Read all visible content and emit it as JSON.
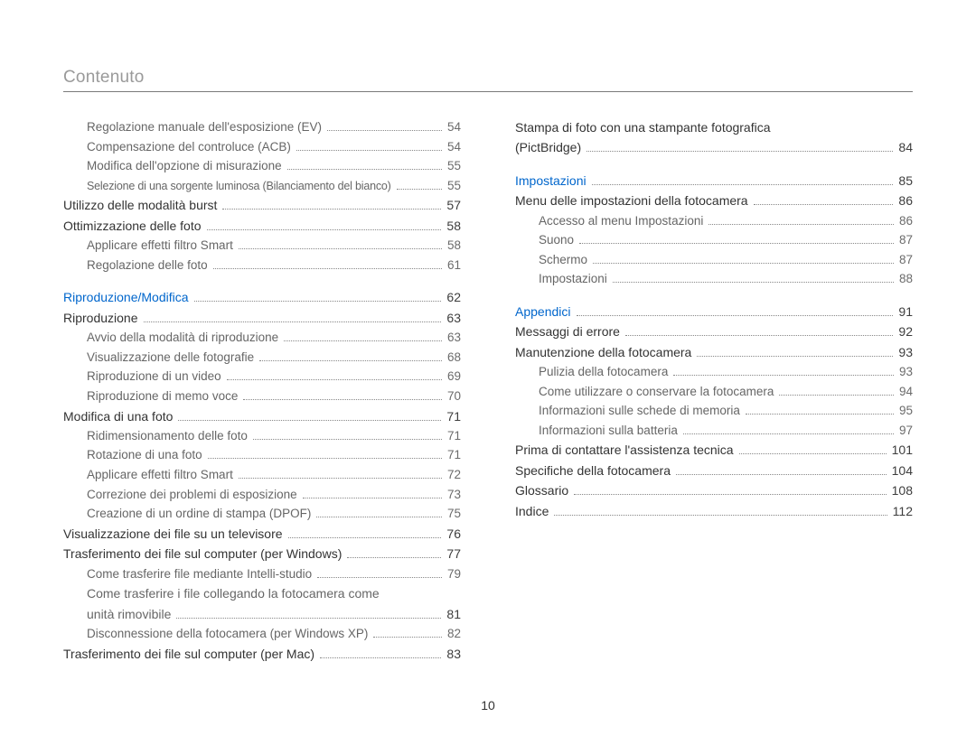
{
  "header": {
    "title": "Contenuto"
  },
  "page_number": "10",
  "left_col": [
    {
      "cls": "level-2",
      "label": "Regolazione manuale dell'esposizione (EV)",
      "page": "54"
    },
    {
      "cls": "level-2",
      "label": "Compensazione del controluce (ACB)",
      "page": "54"
    },
    {
      "cls": "level-2",
      "label": "Modifica dell'opzione di misurazione",
      "page": "55"
    },
    {
      "cls": "level-2 tight",
      "label": "Selezione di una sorgente luminosa (Bilanciamento del bianco)",
      "page": "55"
    },
    {
      "cls": "level-1",
      "label": "Utilizzo delle modalità burst",
      "page": "57"
    },
    {
      "cls": "level-1",
      "label": "Ottimizzazione delle foto",
      "page": "58"
    },
    {
      "cls": "level-2",
      "label": "Applicare effetti filtro Smart",
      "page": "58"
    },
    {
      "cls": "level-2",
      "label": "Regolazione delle foto",
      "page": "61"
    },
    {
      "spacer": true
    },
    {
      "cls": "level-1 section-head",
      "label": "Riproduzione/Modifica",
      "page": "62"
    },
    {
      "cls": "level-1",
      "label": "Riproduzione",
      "page": "63"
    },
    {
      "cls": "level-2",
      "label": "Avvio della modalità di riproduzione",
      "page": "63"
    },
    {
      "cls": "level-2",
      "label": "Visualizzazione delle fotografie",
      "page": "68"
    },
    {
      "cls": "level-2",
      "label": "Riproduzione di un video",
      "page": "69"
    },
    {
      "cls": "level-2",
      "label": "Riproduzione di memo voce",
      "page": "70"
    },
    {
      "cls": "level-1",
      "label": "Modifica di una foto",
      "page": "71"
    },
    {
      "cls": "level-2",
      "label": "Ridimensionamento delle foto",
      "page": "71"
    },
    {
      "cls": "level-2",
      "label": "Rotazione di una foto",
      "page": "71"
    },
    {
      "cls": "level-2",
      "label": "Applicare effetti filtro Smart",
      "page": "72"
    },
    {
      "cls": "level-2",
      "label": "Correzione dei problemi di esposizione",
      "page": "73"
    },
    {
      "cls": "level-2",
      "label": "Creazione di un ordine di stampa (DPOF)",
      "page": "75"
    },
    {
      "cls": "level-1",
      "label": "Visualizzazione dei file su un televisore",
      "page": "76"
    },
    {
      "cls": "level-1",
      "label": "Trasferimento dei file sul computer (per Windows)",
      "page": "77"
    },
    {
      "cls": "level-2",
      "label": "Come trasferire file mediante Intelli-studio",
      "page": "79"
    },
    {
      "cls": "level-2",
      "label_lines": [
        "Come trasferire i file collegando la fotocamera come",
        "unità rimovibile"
      ],
      "page": "81"
    },
    {
      "cls": "level-2",
      "label": "Disconnessione della fotocamera (per Windows XP)",
      "page": "82"
    },
    {
      "cls": "level-1",
      "label": "Trasferimento dei file sul computer (per Mac)",
      "page": "83"
    }
  ],
  "right_col": [
    {
      "cls": "level-1",
      "label_lines": [
        "Stampa di foto con una stampante fotografica",
        "(PictBridge)"
      ],
      "page": "84"
    },
    {
      "spacer": true
    },
    {
      "cls": "level-1 section-head",
      "label": "Impostazioni",
      "page": "85"
    },
    {
      "cls": "level-1",
      "label": "Menu delle impostazioni della fotocamera",
      "page": "86"
    },
    {
      "cls": "level-2",
      "label": "Accesso al menu Impostazioni",
      "page": "86"
    },
    {
      "cls": "level-2",
      "label": "Suono",
      "page": "87"
    },
    {
      "cls": "level-2",
      "label": "Schermo",
      "page": "87"
    },
    {
      "cls": "level-2",
      "label": "Impostazioni",
      "page": "88"
    },
    {
      "spacer": true
    },
    {
      "cls": "level-1 section-head",
      "label": "Appendici",
      "page": "91"
    },
    {
      "cls": "level-1",
      "label": "Messaggi di errore",
      "page": "92"
    },
    {
      "cls": "level-1",
      "label": "Manutenzione della fotocamera",
      "page": "93"
    },
    {
      "cls": "level-2",
      "label": "Pulizia della fotocamera",
      "page": "93"
    },
    {
      "cls": "level-2",
      "label": "Come utilizzare o conservare la fotocamera",
      "page": "94"
    },
    {
      "cls": "level-2",
      "label": "Informazioni sulle schede di memoria",
      "page": "95"
    },
    {
      "cls": "level-2",
      "label": "Informazioni sulla batteria",
      "page": "97"
    },
    {
      "cls": "level-1",
      "label": "Prima di contattare l'assistenza tecnica",
      "page": "101"
    },
    {
      "cls": "level-1",
      "label": "Specifiche della fotocamera",
      "page": "104"
    },
    {
      "cls": "level-1",
      "label": "Glossario",
      "page": "108"
    },
    {
      "cls": "level-1",
      "label": "Indice",
      "page": "112"
    }
  ]
}
